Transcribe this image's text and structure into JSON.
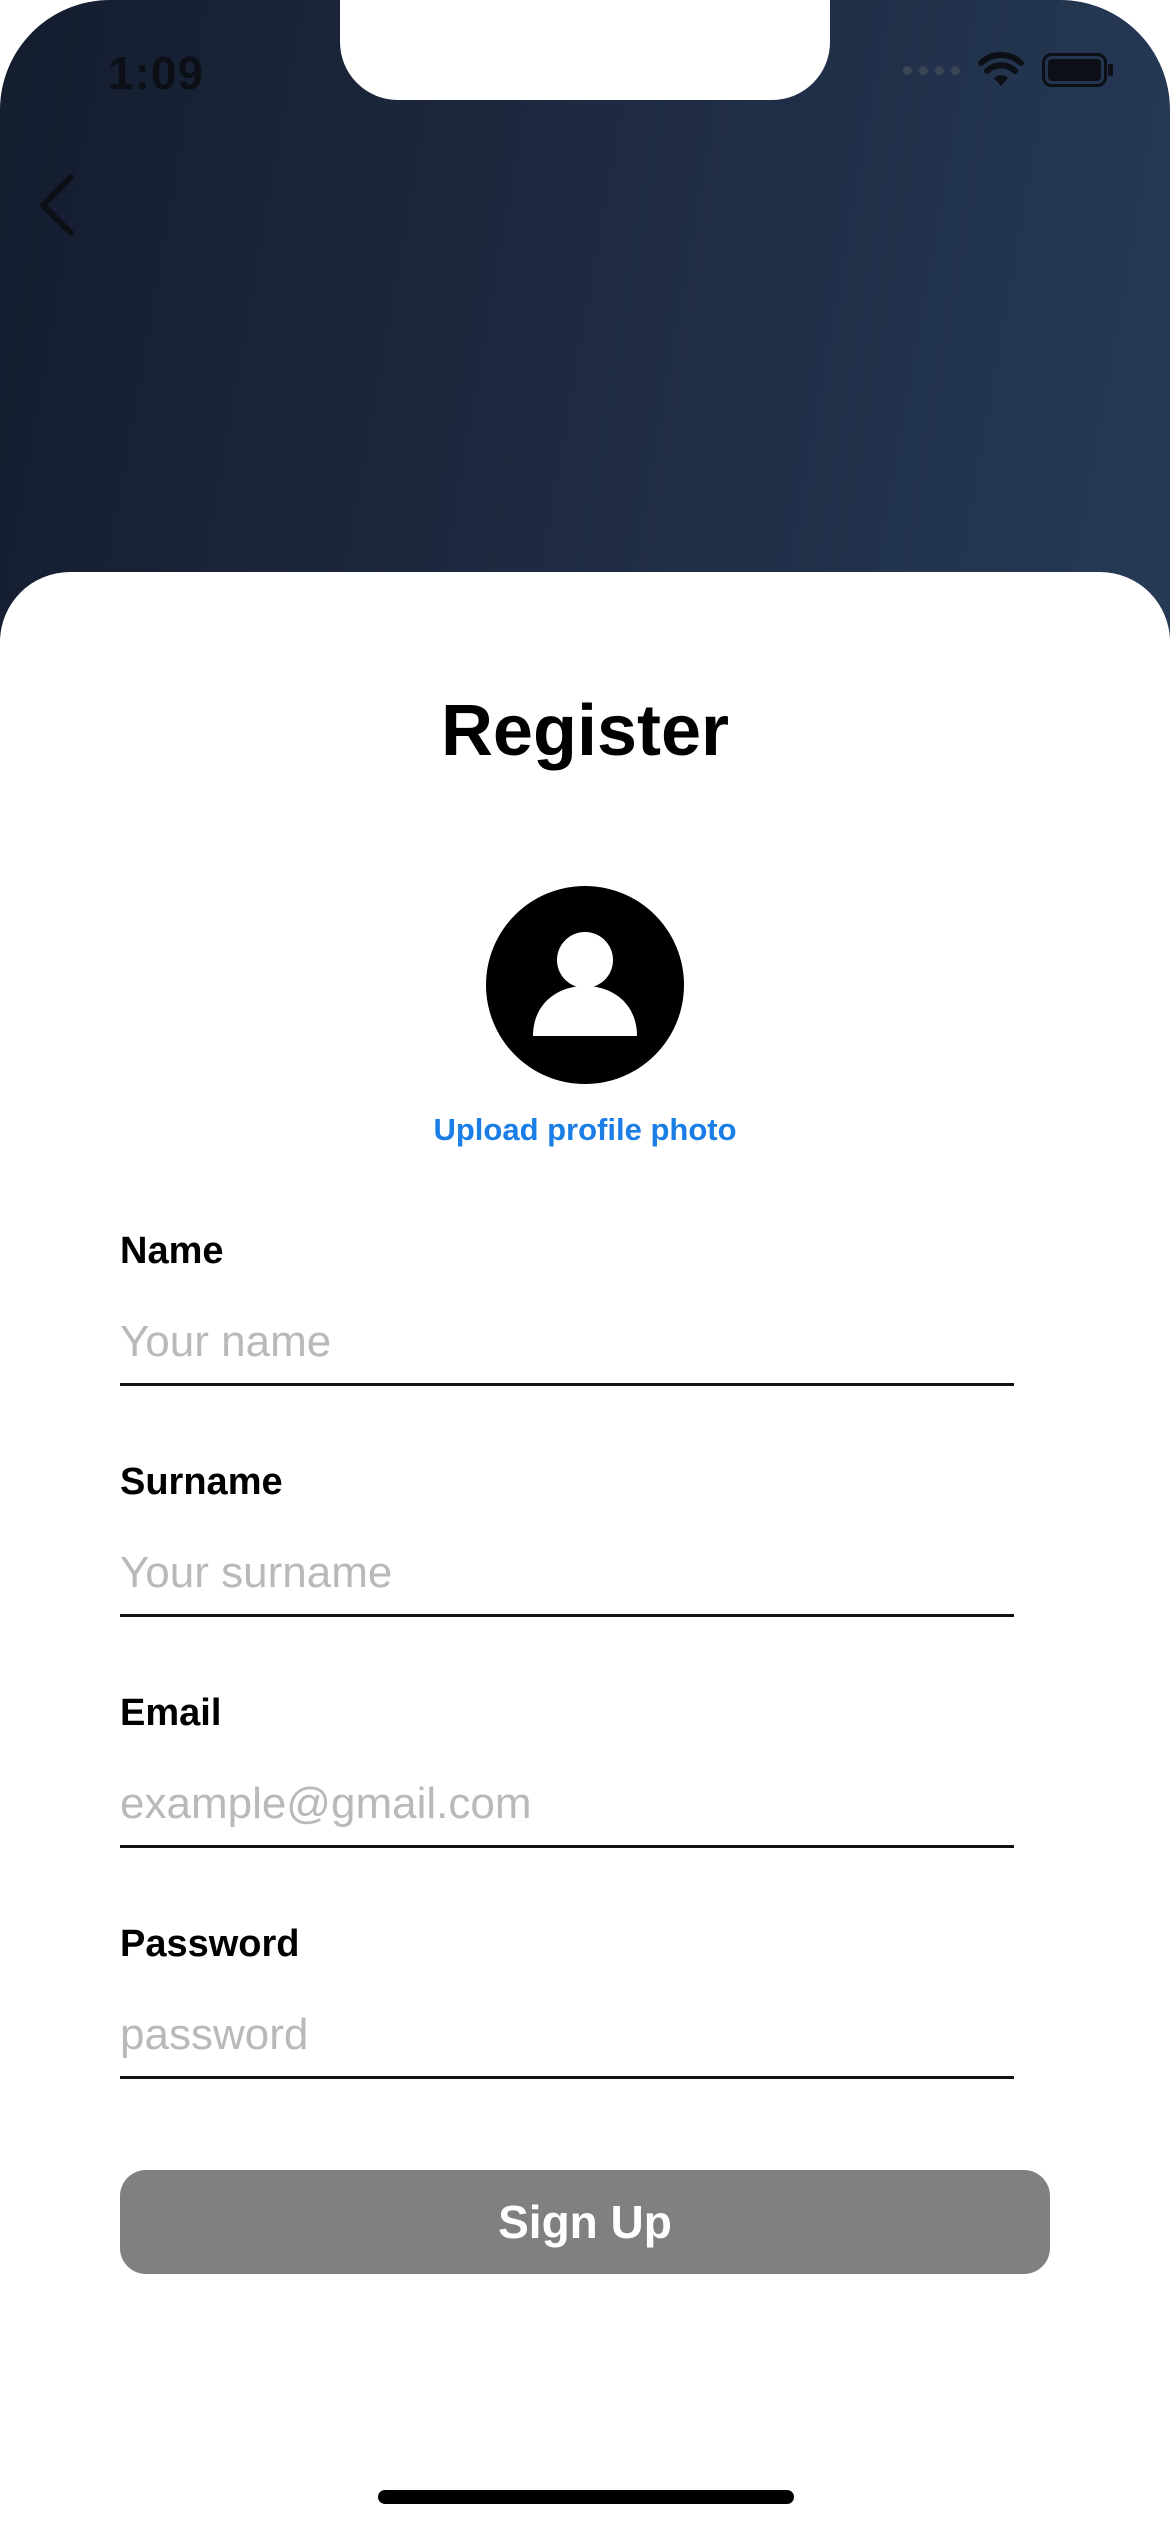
{
  "status_bar": {
    "time": "1:09",
    "icons": [
      "cellular-signal-icon",
      "wifi-icon",
      "battery-icon"
    ]
  },
  "nav": {
    "back_icon": "chevron-left-icon"
  },
  "page": {
    "title": "Register",
    "avatar_icon": "user-placeholder-icon",
    "upload_label": "Upload profile photo"
  },
  "form": {
    "name": {
      "label": "Name",
      "placeholder": "Your name",
      "value": ""
    },
    "surname": {
      "label": "Surname",
      "placeholder": "Your surname",
      "value": ""
    },
    "email": {
      "label": "Email",
      "placeholder": "example@gmail.com",
      "value": ""
    },
    "password": {
      "label": "Password",
      "placeholder": "password",
      "value": ""
    },
    "submit_label": "Sign Up"
  },
  "colors": {
    "header_gradient_start": "#141d2e",
    "header_gradient_end": "#263a56",
    "link_blue": "#1a7ee6",
    "button_disabled_gray": "#808080",
    "placeholder_gray": "#b9b9b9"
  }
}
